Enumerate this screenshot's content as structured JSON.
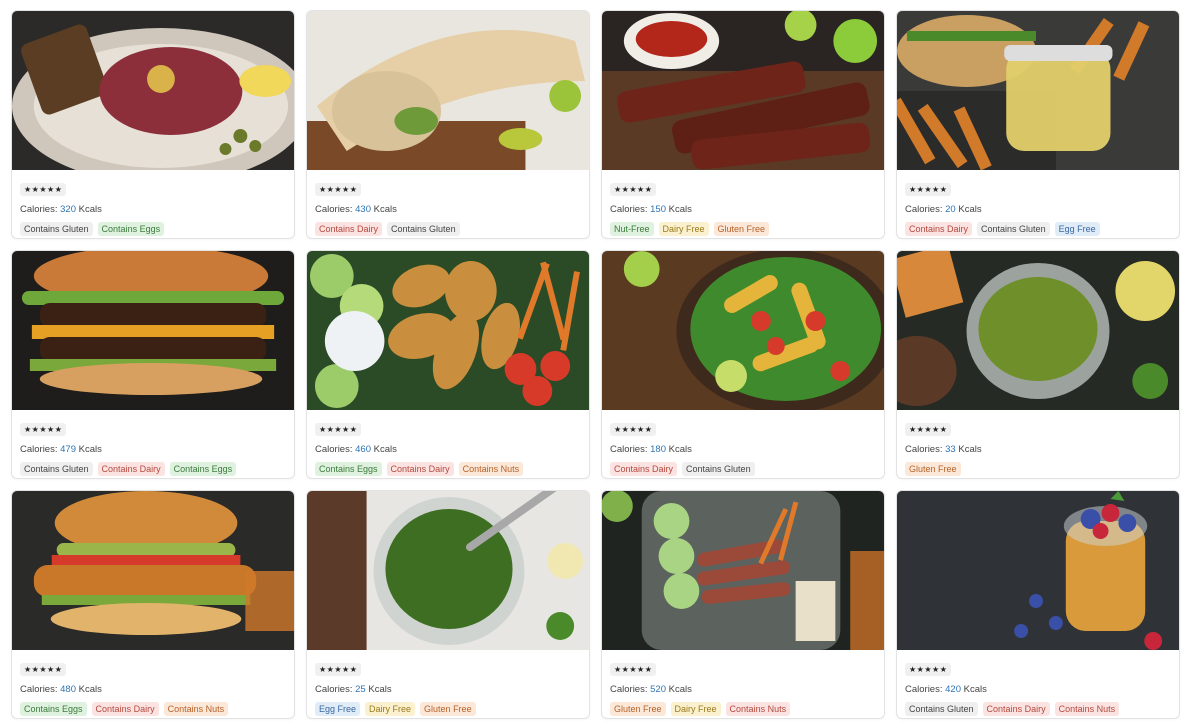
{
  "recipes": [
    {
      "rating": "★★★★★",
      "calories_label": "Calories:",
      "calories": "320",
      "unit": "Kcals",
      "tags": [
        {
          "label": "Contains Gluten",
          "tone": "neutral"
        },
        {
          "label": "Contains Eggs",
          "tone": "green"
        }
      ],
      "image": "beef-tartare-photo",
      "palette": [
        "#2b2a28",
        "#8c2f3a",
        "#d9b24a"
      ]
    },
    {
      "rating": "★★★★★",
      "calories_label": "Calories:",
      "calories": "430",
      "unit": "Kcals",
      "tags": [
        {
          "label": "Contains Dairy",
          "tone": "red"
        },
        {
          "label": "Contains Gluten",
          "tone": "neutral"
        }
      ],
      "image": "chicken-wrap-photo",
      "palette": [
        "#e9e5df",
        "#e6cfa6",
        "#6f9a3a"
      ]
    },
    {
      "rating": "★★★★★",
      "calories_label": "Calories:",
      "calories": "150",
      "unit": "Kcals",
      "tags": [
        {
          "label": "Nut-Free",
          "tone": "green"
        },
        {
          "label": "Dairy Free",
          "tone": "yellow"
        },
        {
          "label": "Gluten Free",
          "tone": "orange"
        }
      ],
      "image": "grilled-ribs-photo",
      "palette": [
        "#2a2422",
        "#6e2419",
        "#8ccb3a"
      ]
    },
    {
      "rating": "★★★★★",
      "calories_label": "Calories:",
      "calories": "20",
      "unit": "Kcals",
      "tags": [
        {
          "label": "Contains Dairy",
          "tone": "red"
        },
        {
          "label": "Contains Gluten",
          "tone": "neutral"
        },
        {
          "label": "Egg Free",
          "tone": "blue"
        }
      ],
      "image": "fries-dip-photo",
      "palette": [
        "#3a3a38",
        "#d07a2a",
        "#e2cf6a"
      ]
    },
    {
      "rating": "★★★★★",
      "calories_label": "Calories:",
      "calories": "479",
      "unit": "Kcals",
      "tags": [
        {
          "label": "Contains Gluten",
          "tone": "neutral"
        },
        {
          "label": "Contains Dairy",
          "tone": "red"
        },
        {
          "label": "Contains Eggs",
          "tone": "green"
        }
      ],
      "image": "double-burger-photo",
      "palette": [
        "#1e1d1b",
        "#c97a38",
        "#e6a024"
      ]
    },
    {
      "rating": "★★★★★",
      "calories_label": "Calories:",
      "calories": "460",
      "unit": "Kcals",
      "tags": [
        {
          "label": "Contains Eggs",
          "tone": "green"
        },
        {
          "label": "Contains Dairy",
          "tone": "red"
        },
        {
          "label": "Contains Nuts",
          "tone": "orange"
        }
      ],
      "image": "chicken-tenders-photo",
      "palette": [
        "#2b4a26",
        "#c98f3e",
        "#d83a2a"
      ]
    },
    {
      "rating": "★★★★★",
      "calories_label": "Calories:",
      "calories": "180",
      "unit": "Kcals",
      "tags": [
        {
          "label": "Contains Dairy",
          "tone": "red"
        },
        {
          "label": "Contains Gluten",
          "tone": "neutral"
        }
      ],
      "image": "corn-salad-photo",
      "palette": [
        "#5b3a22",
        "#e4b53a",
        "#3f8a2c"
      ]
    },
    {
      "rating": "★★★★★",
      "calories_label": "Calories:",
      "calories": "33",
      "unit": "Kcals",
      "tags": [
        {
          "label": "Gluten Free",
          "tone": "orange"
        }
      ],
      "image": "green-sauce-photo",
      "palette": [
        "#262a24",
        "#6f8f2a",
        "#d8883a"
      ]
    },
    {
      "rating": "★★★★★",
      "calories_label": "Calories:",
      "calories": "480",
      "unit": "Kcals",
      "tags": [
        {
          "label": "Contains Eggs",
          "tone": "green"
        },
        {
          "label": "Contains Dairy",
          "tone": "red"
        },
        {
          "label": "Contains Nuts",
          "tone": "orange"
        }
      ],
      "image": "crispy-chicken-burger-photo",
      "palette": [
        "#2a2a28",
        "#d08a3a",
        "#9ab54a"
      ]
    },
    {
      "rating": "★★★★★",
      "calories_label": "Calories:",
      "calories": "25",
      "unit": "Kcals",
      "tags": [
        {
          "label": "Egg Free",
          "tone": "blue"
        },
        {
          "label": "Dairy Free",
          "tone": "yellow"
        },
        {
          "label": "Gluten Free",
          "tone": "orange"
        }
      ],
      "image": "chimichurri-photo",
      "palette": [
        "#e8e6e2",
        "#3e6e22",
        "#5b3a2a"
      ]
    },
    {
      "rating": "★★★★★",
      "calories_label": "Calories:",
      "calories": "520",
      "unit": "Kcals",
      "tags": [
        {
          "label": "Gluten Free",
          "tone": "orange"
        },
        {
          "label": "Dairy Free",
          "tone": "yellow"
        },
        {
          "label": "Contains Nuts",
          "tone": "red"
        }
      ],
      "image": "steak-meal-prep-photo",
      "palette": [
        "#1f2420",
        "#9b4a3a",
        "#7fb04a"
      ]
    },
    {
      "rating": "★★★★★",
      "calories_label": "Calories:",
      "calories": "420",
      "unit": "Kcals",
      "tags": [
        {
          "label": "Contains Gluten",
          "tone": "neutral"
        },
        {
          "label": "Contains Dairy",
          "tone": "red"
        },
        {
          "label": "Contains Nuts",
          "tone": "red"
        }
      ],
      "image": "berry-parfait-photo",
      "palette": [
        "#1e2226",
        "#d89a3a",
        "#3a4fa8"
      ]
    }
  ]
}
